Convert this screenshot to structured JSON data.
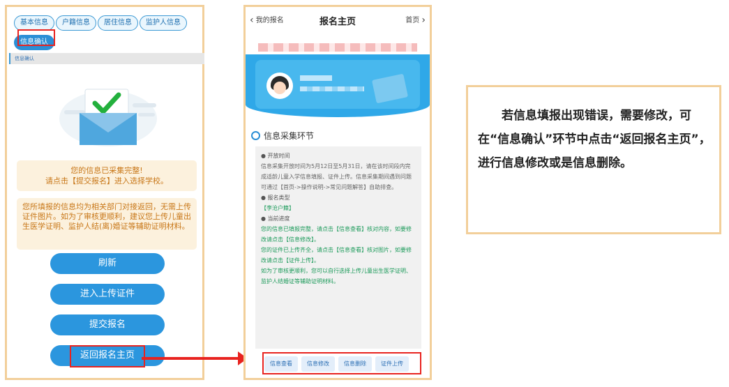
{
  "left_screen": {
    "tabs": [
      "基本信息",
      "户籍信息",
      "居住信息",
      "监护人信息"
    ],
    "active_tab": "信息确认",
    "breadcrumb": "信息确认",
    "message_complete_line1": "您的信息已采集完整!",
    "message_complete_line2": "请点击【提交报名】进入选择学校。",
    "message_notice": "您所填报的信息均为相关部门对接返回，无需上传证件图片。如为了审核更顺利，建议您上传儿童出生医学证明、监护人结(离)婚证等辅助证明材料。",
    "buttons": {
      "refresh": "刷新",
      "upload": "进入上传证件",
      "submit": "提交报名",
      "back_home": "返回报名主页"
    }
  },
  "right_screen": {
    "nav": {
      "back": "我的报名",
      "title": "报名主页",
      "home": "首页"
    },
    "section_title": "信息采集环节",
    "open_time_label": "● 开放时间",
    "open_time_text": "信息采集开放时间为5月12日至5月31日，请在该时间段内完成适龄儿童入学信息填报、证件上传。信息采集期间遇到问题可通过【首页->操作说明->常见问题解答】自助排查。",
    "type_label": "● 报名类型",
    "type_value": "【李沧户籍】",
    "progress_label": "● 当前进度",
    "progress_1": "您的信息已填报完整，请点击【信息查看】核对内容，如要修改请点击【信息修改】。",
    "progress_2": "您的证件已上传齐全，请点击【信息查看】核对图片，如要修改请点击【证件上传】。",
    "progress_3": "如为了审核更顺利，您可以自行选择上传儿童出生医学证明、监护人结婚证等辅助证明材料。",
    "actions": [
      "信息查看",
      "信息修改",
      "信息删除",
      "证件上传"
    ]
  },
  "note": {
    "text": "若信息填报出现错误，需要修改，可在“信息确认”环节中点击“返回报名主页”，进行信息修改或是信息删除。"
  },
  "colors": {
    "accent": "#2b96de",
    "highlight": "#e8231f",
    "frame": "#f2cf9a"
  }
}
